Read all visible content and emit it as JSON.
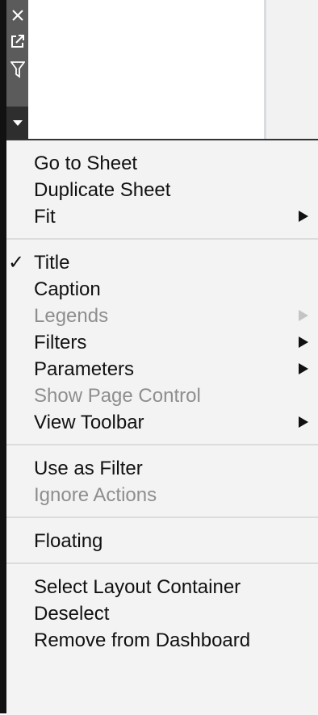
{
  "toolbar": {
    "icons": [
      "close-icon",
      "open-external-icon",
      "filter-icon",
      "more-options-icon"
    ]
  },
  "menu": {
    "sections": [
      {
        "items": [
          {
            "label": "Go to Sheet",
            "disabled": false,
            "submenu": false,
            "checked": false
          },
          {
            "label": "Duplicate Sheet",
            "disabled": false,
            "submenu": false,
            "checked": false
          },
          {
            "label": "Fit",
            "disabled": false,
            "submenu": true,
            "checked": false
          }
        ]
      },
      {
        "items": [
          {
            "label": "Title",
            "disabled": false,
            "submenu": false,
            "checked": true
          },
          {
            "label": "Caption",
            "disabled": false,
            "submenu": false,
            "checked": false
          },
          {
            "label": "Legends",
            "disabled": true,
            "submenu": true,
            "checked": false
          },
          {
            "label": "Filters",
            "disabled": false,
            "submenu": true,
            "checked": false
          },
          {
            "label": "Parameters",
            "disabled": false,
            "submenu": true,
            "checked": false
          },
          {
            "label": "Show Page Control",
            "disabled": true,
            "submenu": false,
            "checked": false
          },
          {
            "label": "View Toolbar",
            "disabled": false,
            "submenu": true,
            "checked": false
          }
        ]
      },
      {
        "items": [
          {
            "label": "Use as Filter",
            "disabled": false,
            "submenu": false,
            "checked": false
          },
          {
            "label": "Ignore Actions",
            "disabled": true,
            "submenu": false,
            "checked": false
          }
        ]
      },
      {
        "items": [
          {
            "label": "Floating",
            "disabled": false,
            "submenu": false,
            "checked": false
          }
        ]
      },
      {
        "items": [
          {
            "label": "Select Layout Container",
            "disabled": false,
            "submenu": false,
            "checked": false
          },
          {
            "label": "Deselect",
            "disabled": false,
            "submenu": false,
            "checked": false
          },
          {
            "label": "Remove from Dashboard",
            "disabled": false,
            "submenu": false,
            "checked": false
          }
        ]
      }
    ],
    "check_mark": "✓"
  }
}
